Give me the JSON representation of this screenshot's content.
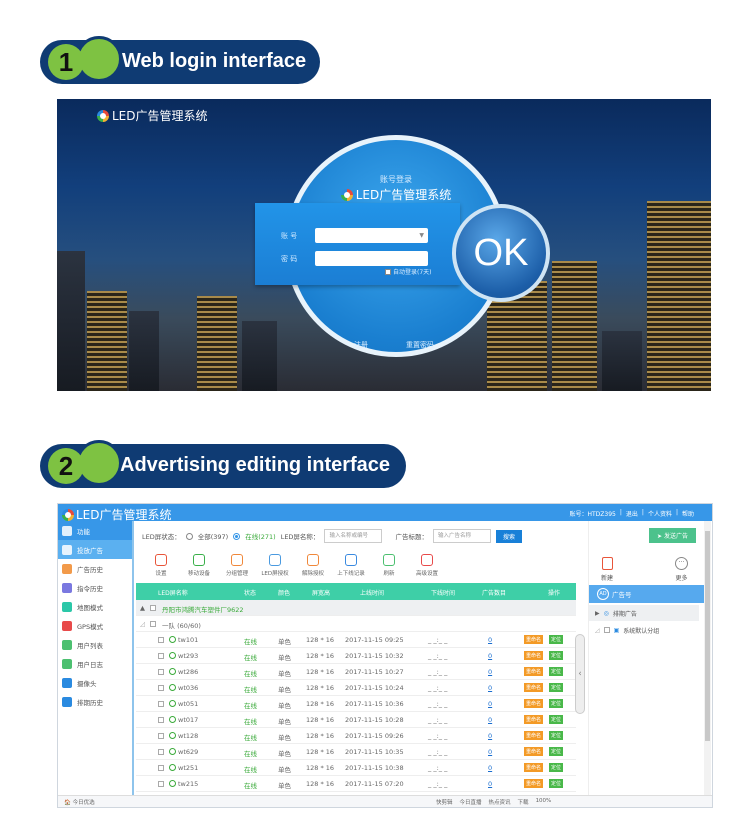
{
  "section1": {
    "number": "1",
    "title": "Web login interface"
  },
  "section2": {
    "number": "2",
    "title": "Advertising editing interface"
  },
  "login": {
    "brand": "LED广告管理系统",
    "subtitle": "账号登录",
    "system_title": "LED广告管理系统",
    "account_label": "账 号",
    "password_label": "密 码",
    "account_value": "",
    "password_value": "",
    "remember_label": "自动登录(7天)",
    "remember_checked": true,
    "register_link": "注册",
    "reset_link": "重置密码",
    "ok_label": "OK"
  },
  "app": {
    "title": "LED广告管理系统",
    "account": "账号：HTDZ395",
    "logout": "退出",
    "profile": "个人资料",
    "help": "帮助",
    "sidebar": [
      {
        "label": "功能",
        "icon": "grid-icon",
        "color": "#ffffff"
      },
      {
        "label": "投放广告",
        "icon": "broadcast-icon",
        "color": "#ffffff"
      },
      {
        "label": "广告历史",
        "icon": "history-icon",
        "color": "#f29a4a"
      },
      {
        "label": "指令历史",
        "icon": "command-icon",
        "color": "#7a78e0"
      },
      {
        "label": "地图模式",
        "icon": "map-icon",
        "color": "#2bc7a8"
      },
      {
        "label": "GPS模式",
        "icon": "gps-icon",
        "color": "#e84a4a"
      },
      {
        "label": "用户列表",
        "icon": "user-list-icon",
        "color": "#4cc070"
      },
      {
        "label": "用户日志",
        "icon": "user-log-icon",
        "color": "#4cc070"
      },
      {
        "label": "摄像头",
        "icon": "camera-icon",
        "color": "#2a8ae0"
      },
      {
        "label": "排期历史",
        "icon": "schedule-icon",
        "color": "#2a8ae0"
      }
    ],
    "filter": {
      "status_label": "LED屏状态：",
      "all_label": "全部(397)",
      "online_label": "在线(271)",
      "selected": "online",
      "name_label": "LED屏名称：",
      "name_placeholder": "输入名称或编号",
      "ad_title_label": "广告标题：",
      "ad_placeholder": "输入广告名称",
      "search_label": "搜索",
      "send_label": "发送广告"
    },
    "tools": [
      {
        "label": "设置",
        "icon": "settings-icon",
        "color": "#e8553a"
      },
      {
        "label": "移动设备",
        "icon": "move-device-icon",
        "color": "#3ab04a"
      },
      {
        "label": "分组管理",
        "icon": "group-icon",
        "color": "#f0883a"
      },
      {
        "label": "LED屏授权",
        "icon": "shield-icon",
        "color": "#4a9ae0"
      },
      {
        "label": "解除授权",
        "icon": "unlock-icon",
        "color": "#f0883a"
      },
      {
        "label": "上下线记录",
        "icon": "record-icon",
        "color": "#3a8ae0"
      },
      {
        "label": "刷新",
        "icon": "refresh-icon",
        "color": "#4cc070"
      },
      {
        "label": "高级设置",
        "icon": "advanced-settings-icon",
        "color": "#e84a4a"
      }
    ],
    "columns": [
      "LED屏名称",
      "状态",
      "颜色",
      "屏宽高",
      "上线时间",
      "下线时间",
      "广告数目",
      "操作"
    ],
    "group1": "丹阳市鸿腾汽车塑件厂9622",
    "group2": "一队 (60/60)",
    "rows": [
      {
        "name": "tw101",
        "status": "在线",
        "color": "单色",
        "size": "128 * 16",
        "online": "2017-11-15 09:25",
        "offline": "_ _:_ _",
        "ads": "0"
      },
      {
        "name": "wt293",
        "status": "在线",
        "color": "单色",
        "size": "128 * 16",
        "online": "2017-11-15 10:32",
        "offline": "_ _:_ _",
        "ads": "0"
      },
      {
        "name": "wt286",
        "status": "在线",
        "color": "单色",
        "size": "128 * 16",
        "online": "2017-11-15 10:27",
        "offline": "_ _:_ _",
        "ads": "0"
      },
      {
        "name": "wt036",
        "status": "在线",
        "color": "单色",
        "size": "128 * 16",
        "online": "2017-11-15 10:24",
        "offline": "_ _:_ _",
        "ads": "0"
      },
      {
        "name": "wt051",
        "status": "在线",
        "color": "单色",
        "size": "128 * 16",
        "online": "2017-11-15 10:36",
        "offline": "_ _:_ _",
        "ads": "0"
      },
      {
        "name": "wt017",
        "status": "在线",
        "color": "单色",
        "size": "128 * 16",
        "online": "2017-11-15 10:28",
        "offline": "_ _:_ _",
        "ads": "0"
      },
      {
        "name": "wt128",
        "status": "在线",
        "color": "单色",
        "size": "128 * 16",
        "online": "2017-11-15 09:26",
        "offline": "_ _:_ _",
        "ads": "0"
      },
      {
        "name": "wt629",
        "status": "在线",
        "color": "单色",
        "size": "128 * 16",
        "online": "2017-11-15 10:35",
        "offline": "_ _:_ _",
        "ads": "0"
      },
      {
        "name": "wt251",
        "status": "在线",
        "color": "单色",
        "size": "128 * 16",
        "online": "2017-11-15 10:38",
        "offline": "_ _:_ _",
        "ads": "0"
      },
      {
        "name": "tw215",
        "status": "在线",
        "color": "单色",
        "size": "128 * 16",
        "online": "2017-11-15 07:20",
        "offline": "_ _:_ _",
        "ads": "0"
      }
    ],
    "row_actions": {
      "rename": "重命名",
      "locate": "定位"
    },
    "right": {
      "new_label": "新建",
      "more_label": "更多",
      "header": "广告号",
      "badge": "AD",
      "tree1": "排期广告",
      "tree2": "系统默认分组"
    },
    "statusbar": {
      "left": "今日优选",
      "items": [
        "快剪辑",
        "今日直播",
        "热点资讯",
        "下载"
      ],
      "zoom": "100%"
    }
  }
}
